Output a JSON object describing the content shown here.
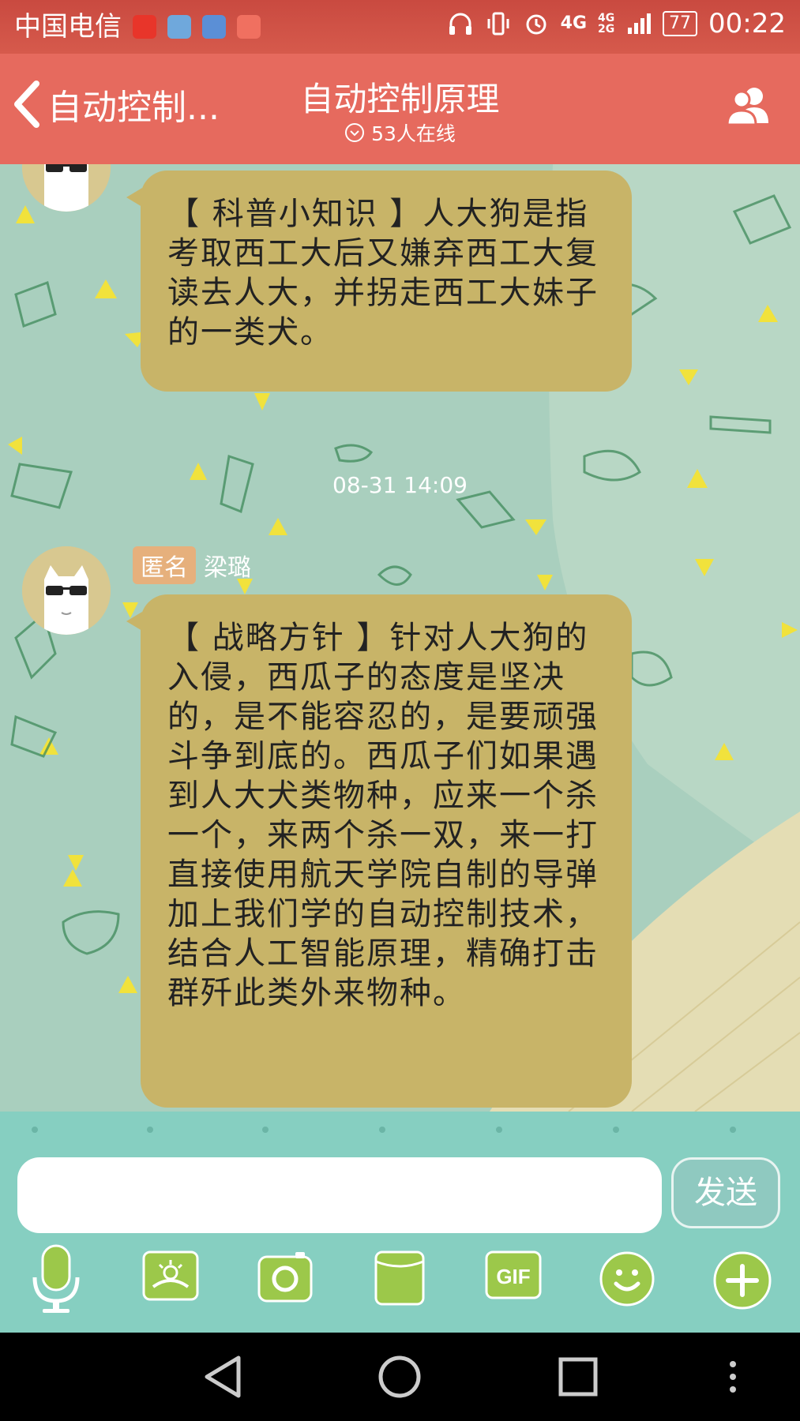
{
  "status_bar": {
    "carrier": "中国电信",
    "network_top": "4G",
    "network_stack": "4G 2G",
    "battery": "77",
    "time": "00:22"
  },
  "header": {
    "back_label": "自动控制...",
    "title": "自动控制原理",
    "subtitle": "53人在线"
  },
  "messages": [
    {
      "text": "【 科普小知识 】人大狗是指考取西工大后又嫌弃西工大复读去人大，并拐走西工大妹子的一类犬。"
    },
    {
      "timestamp": "08-31 14:09",
      "sender_tag": "匿名",
      "sender_name": "梁璐",
      "text": "【 战略方针 】针对人大狗的入侵，西瓜子的态度是坚决的，是不能容忍的，是要顽强斗争到底的。西瓜子们如果遇到人大犬类物种，应来一个杀一个，来两个杀一双，来一打直接使用航天学院自制的导弹加上我们学的自动控制技术，结合人工智能原理，精确打击群歼此类外来物种。"
    }
  ],
  "composer": {
    "input_value": "",
    "send_label": "发送",
    "gif_label": "GIF"
  },
  "icons": {
    "back": "chevron-left-icon",
    "members": "group-members-icon",
    "online": "chevron-down-circle-icon",
    "voice": "microphone-icon",
    "image": "image-icon",
    "camera": "camera-icon",
    "file": "file-icon",
    "gif": "gif-icon",
    "emoji": "emoji-icon",
    "more": "plus-icon"
  },
  "colors": {
    "status_bar": "#d65a4c",
    "title_bar": "#e66a5e",
    "bubble": "#c8b468",
    "input_panel": "#86cfc1",
    "tool_green": "#9cc84a"
  }
}
